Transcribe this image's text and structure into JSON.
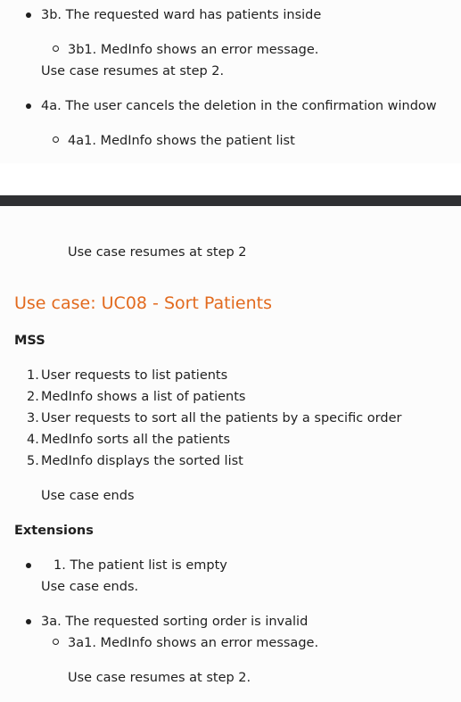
{
  "top": {
    "ext_3b": "3b. The requested ward has patients inside",
    "ext_3b1": "3b1. MedInfo shows an error message.",
    "ext_3b_resume": "Use case resumes at step 2.",
    "ext_4a": "4a. The user cancels the deletion in the confirmation window",
    "ext_4a1": "4a1. MedInfo shows the patient list"
  },
  "bottom": {
    "resume_step2": "Use case resumes at step 2",
    "uc_title": "Use case: UC08 - Sort Patients",
    "mss_heading": "MSS",
    "mss_steps": [
      {
        "num": "1.",
        "text": "User requests to list patients"
      },
      {
        "num": "2.",
        "text": "MedInfo shows a list of patients"
      },
      {
        "num": "3.",
        "text": "User requests to sort all the patients by a specific order"
      },
      {
        "num": "4.",
        "text": "MedInfo sorts all the patients"
      },
      {
        "num": "5.",
        "text": "MedInfo displays the sorted list"
      }
    ],
    "mss_end": "Use case ends",
    "extensions_heading": "Extensions",
    "ext_1": "1. The patient list is empty",
    "ext_1_end": "Use case ends.",
    "ext_3a": "3a. The requested sorting order is invalid",
    "ext_3a1": "3a1. MedInfo shows an error message.",
    "ext_3a_resume": "Use case resumes at step 2."
  }
}
